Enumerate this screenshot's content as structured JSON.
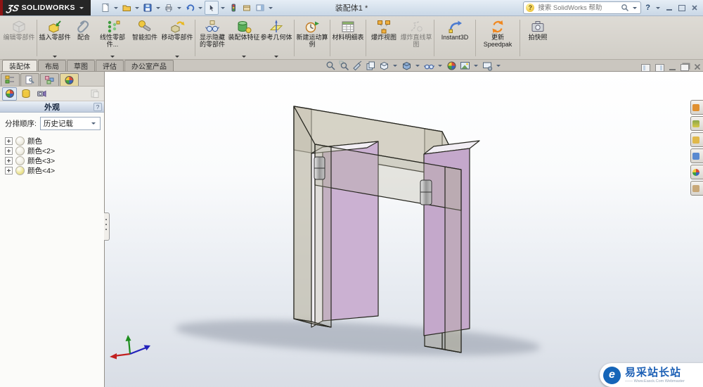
{
  "title_bar": {
    "logo_mark": "ƷS",
    "logo_text": "SOLIDWORKS",
    "document_title": "装配体1 *",
    "search_placeholder": "搜索 SolidWorks 帮助",
    "help_glyph": "?"
  },
  "quick_access_icons": [
    "new-document",
    "open",
    "save",
    "print",
    "undo",
    "select",
    "selection-filter",
    "options",
    "task-pane-toggle"
  ],
  "ribbon": {
    "tabs": [
      {
        "label": "装配体",
        "active": true
      },
      {
        "label": "布局"
      },
      {
        "label": "草图"
      },
      {
        "label": "评估"
      },
      {
        "label": "办公室产品"
      }
    ],
    "buttons": [
      {
        "label": "编辑零部件",
        "icon": "edit-component",
        "disabled": true
      },
      {
        "label": "插入零部件",
        "icon": "insert-component",
        "dropdown": true
      },
      {
        "label": "配合",
        "icon": "mate"
      },
      {
        "label": "线性零部件...",
        "icon": "linear-component-pattern",
        "dropdown": true
      },
      {
        "label": "智能扣件",
        "icon": "smart-fasteners"
      },
      {
        "label": "移动零部件",
        "icon": "move-component",
        "dropdown": true
      },
      {
        "label": "显示隐藏的零部件",
        "icon": "show-hidden-components"
      },
      {
        "label": "装配体特征",
        "icon": "assembly-features",
        "dropdown": true
      },
      {
        "label": "参考几何体",
        "icon": "reference-geometry",
        "dropdown": true
      },
      {
        "label": "新建运动算例",
        "icon": "new-motion-study"
      },
      {
        "label": "材料明细表",
        "icon": "bill-of-materials"
      },
      {
        "label": "爆炸视图",
        "icon": "exploded-view"
      },
      {
        "label": "爆炸直线草图",
        "icon": "explode-line-sketch",
        "disabled": true
      },
      {
        "label": "Instant3D",
        "icon": "instant3d"
      },
      {
        "label": "更新 Speedpak",
        "icon": "update-speedpak"
      },
      {
        "label": "拍快照",
        "icon": "take-snapshot"
      }
    ]
  },
  "left_panel": {
    "tabs": [
      "feature-manager",
      "property-manager",
      "configuration-manager",
      "display-manager"
    ],
    "active_tab": "display-manager",
    "toolbar": [
      "appearances",
      "decals",
      "scene-lights",
      "copy-appearance"
    ],
    "header": {
      "title": "外观",
      "help": "?"
    },
    "sort": {
      "label": "分排顺序:",
      "value": "历史记载"
    },
    "tree": [
      {
        "label": "颜色",
        "icon_color": "#edebe0"
      },
      {
        "label": "颜色<2>",
        "icon_color": "#edebe0"
      },
      {
        "label": "颜色<3>",
        "icon_color": "#edebe0"
      },
      {
        "label": "颜色<4>",
        "icon_color": "#ebe287"
      }
    ]
  },
  "viewport": {
    "heads_up_icons": [
      "zoom-to-fit",
      "zoom-to-area",
      "section-view",
      "3d-drawing-view",
      "view-orientation",
      "display-style",
      "hide-show-items",
      "edit-appearance",
      "apply-scene",
      "view-settings"
    ],
    "window_control_icons": [
      "pane-left",
      "pane-right",
      "minimize",
      "restore",
      "close"
    ],
    "task_pane_icons": [
      "home",
      "design-library",
      "file-explorer",
      "view-palette",
      "appearances",
      "custom-properties"
    ],
    "model_colors": {
      "frame": "#b7b2a0",
      "panel": "#c9aed2",
      "hinge": "#9c9c9c",
      "shadow": "#8b93a1"
    }
  },
  "watermark": {
    "logo_glyph": "e",
    "title": "易采站长站",
    "subtitle": "—— Www.Easck.Com Webmaster"
  }
}
